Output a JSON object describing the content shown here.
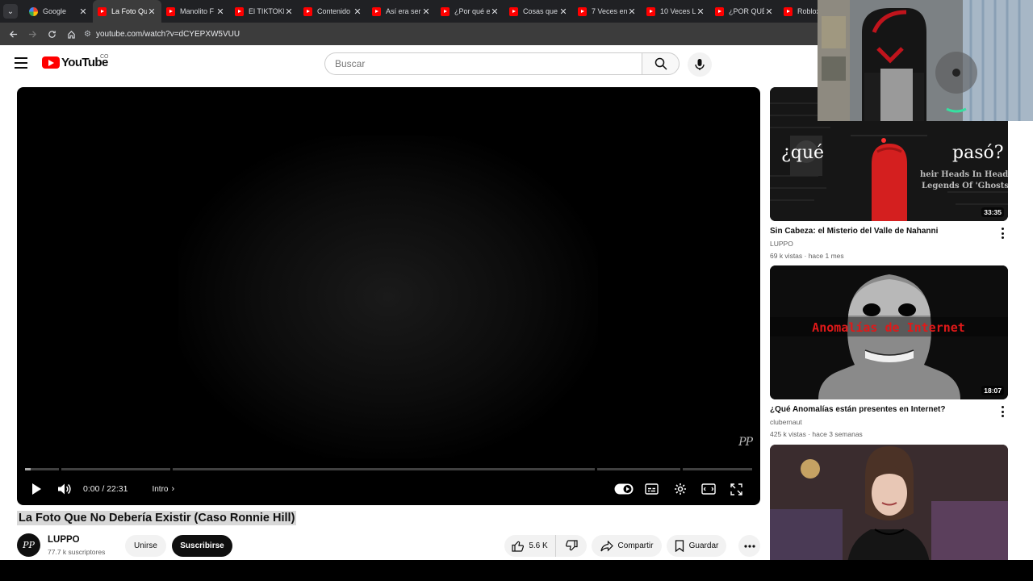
{
  "browser": {
    "tabs": [
      {
        "label": "Google",
        "favicon": "google-icon",
        "active": false
      },
      {
        "label": "La Foto Que",
        "favicon": "youtube-icon",
        "active": true
      },
      {
        "label": "Manolito F",
        "favicon": "youtube-icon",
        "active": false
      },
      {
        "label": "El TIKTOKE",
        "favicon": "youtube-icon",
        "active": false
      },
      {
        "label": "Contenido",
        "favicon": "youtube-icon",
        "active": false
      },
      {
        "label": "Así era ser",
        "favicon": "youtube-icon",
        "active": false
      },
      {
        "label": "¿Por qué e",
        "favicon": "youtube-icon",
        "active": false
      },
      {
        "label": "Cosas que",
        "favicon": "youtube-icon",
        "active": false
      },
      {
        "label": "7 Veces en",
        "favicon": "youtube-icon",
        "active": false
      },
      {
        "label": "10 Veces L",
        "favicon": "youtube-icon",
        "active": false
      },
      {
        "label": "¿POR QUÉ",
        "favicon": "youtube-icon",
        "active": false
      },
      {
        "label": "Roblox",
        "favicon": "youtube-icon",
        "active": false
      }
    ],
    "url": "youtube.com/watch?v=dCYEPXW5VUU"
  },
  "header": {
    "logo_text": "YouTube",
    "country_code": "CO",
    "search_placeholder": "Buscar"
  },
  "player": {
    "time_display": "0:00 / 22:31",
    "chapter": "Intro",
    "watermark": "PP",
    "progress": 0,
    "autoplay": true
  },
  "video": {
    "title": "La Foto Que No Debería Existir (Caso Ronnie Hill)",
    "channel": {
      "name": "LUPPO",
      "subscribers": "77.7 k suscriptores",
      "avatar_text": "PP"
    },
    "join_label": "Unirse",
    "subscribe_label": "Suscribirse",
    "likes": "5.6 K",
    "share_label": "Compartir",
    "save_label": "Guardar"
  },
  "recommendations": [
    {
      "title": "Sin Cabeza: el Misterio del Valle de Nahanni",
      "channel": "LUPPO",
      "meta": "69 k vistas · hace 1 mes",
      "duration": "33:35",
      "thumb_text_left": "¿qué",
      "thumb_text_right": "pasó?",
      "thumb_caption_1": "heir Heads In Headless",
      "thumb_caption_2": "Legends Of 'Ghosts'"
    },
    {
      "title": "¿Qué Anomalías están presentes en Internet?",
      "channel": "clubernaut",
      "meta": "425 k vistas · hace 3 semanas",
      "duration": "18:07",
      "thumb_text": "Anomalías de Internet"
    },
    {
      "title": "",
      "channel": "",
      "meta": "",
      "duration": ""
    }
  ],
  "colors": {
    "brand_red": "#ff0000",
    "chrome_dark": "#202124",
    "text_primary": "#0f0f0f",
    "text_secondary": "#606060"
  }
}
